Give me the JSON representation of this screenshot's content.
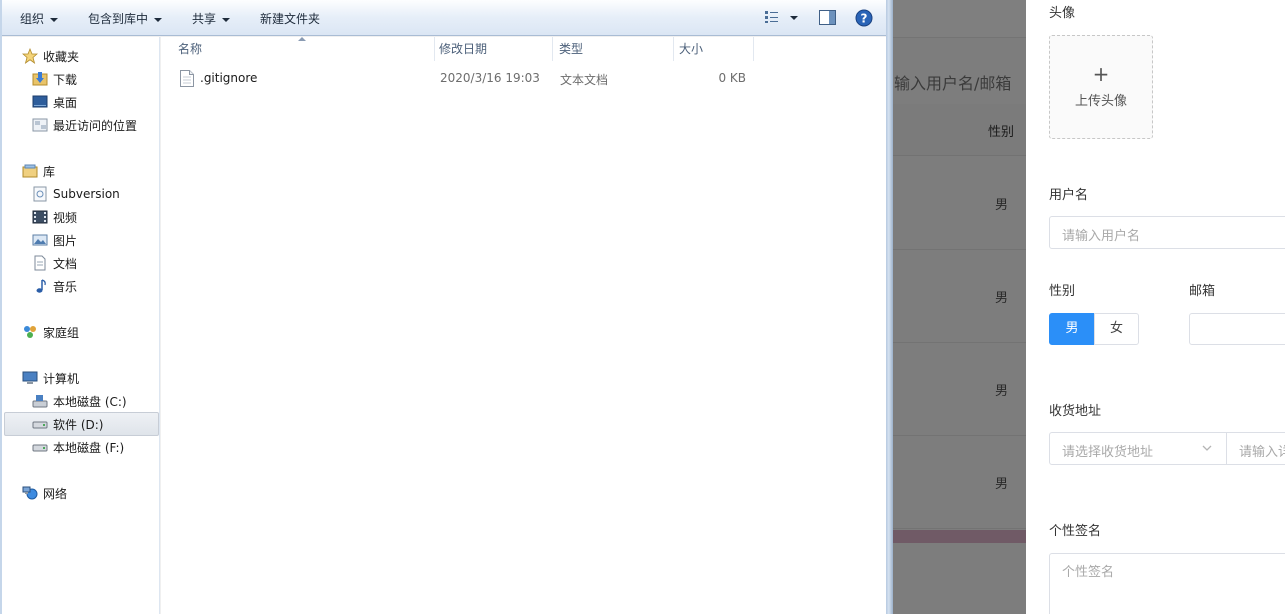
{
  "explorer": {
    "toolbar": {
      "organize": "组织",
      "include_in_library": "包含到库中",
      "share": "共享",
      "new_folder": "新建文件夹"
    },
    "nav": {
      "favorites": "收藏夹",
      "downloads": "下载",
      "desktop": "桌面",
      "recent_places": "最近访问的位置",
      "libraries": "库",
      "subversion": "Subversion",
      "videos": "视频",
      "pictures": "图片",
      "documents": "文档",
      "music": "音乐",
      "homegroup": "家庭组",
      "computer": "计算机",
      "drive_c": "本地磁盘 (C:)",
      "drive_d": "软件 (D:)",
      "drive_f": "本地磁盘 (F:)",
      "network": "网络"
    },
    "columns": {
      "name": "名称",
      "modified": "修改日期",
      "type": "类型",
      "size": "大小"
    },
    "files": [
      {
        "name": ".gitignore",
        "modified": "2020/3/16 19:03",
        "type": "文本文档",
        "size": "0 KB"
      }
    ]
  },
  "background_page": {
    "search_placeholder": "输入用户名/邮箱",
    "gender_header": "性别",
    "rows": [
      "男",
      "男",
      "男",
      "男"
    ]
  },
  "drawer": {
    "avatar_label": "头像",
    "upload_plus": "+",
    "upload_text": "上传头像",
    "username_label": "用户名",
    "username_placeholder": "请输入用户名",
    "gender_label": "性别",
    "gender_male": "男",
    "gender_female": "女",
    "selected_gender": "男",
    "email_label": "邮箱",
    "address_label": "收货地址",
    "address_select_placeholder": "请选择收货地址",
    "address_detail_placeholder": "请输入详细地址",
    "signature_label": "个性签名",
    "signature_placeholder": "个性签名",
    "accent_color": "#2b8ff8"
  }
}
